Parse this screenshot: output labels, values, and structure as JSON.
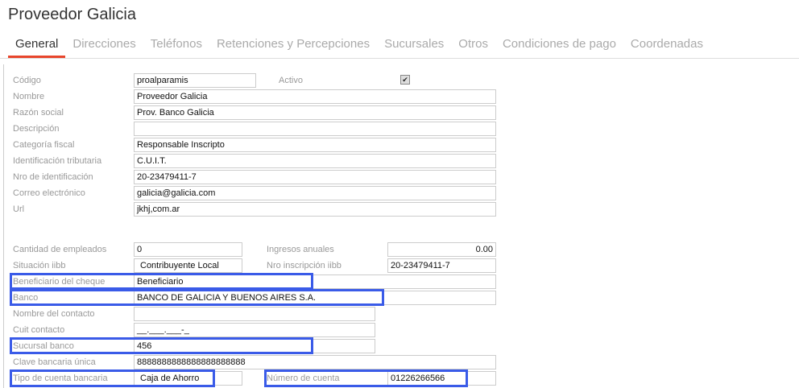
{
  "title": "Proveedor Galicia",
  "tabs": [
    "General",
    "Direcciones",
    "Teléfonos",
    "Retenciones y Percepciones",
    "Sucursales",
    "Otros",
    "Condiciones de pago",
    "Coordenadas"
  ],
  "fields": {
    "codigo": {
      "label": "Código",
      "value": "proalparamis"
    },
    "activo": {
      "label": "Activo",
      "checked": true,
      "mark": "✔"
    },
    "nombre": {
      "label": "Nombre",
      "value": "Proveedor Galicia"
    },
    "razon": {
      "label": "Razón social",
      "value": "Prov. Banco Galicia"
    },
    "descripcion": {
      "label": "Descripción",
      "value": ""
    },
    "categoria": {
      "label": "Categoría fiscal",
      "value": "Responsable Inscripto"
    },
    "identificacion": {
      "label": "Identificación tributaria",
      "value": "C.U.I.T."
    },
    "nro_id": {
      "label": "Nro de identificación",
      "value": "20-23479411-7"
    },
    "correo": {
      "label": "Correo electrónico",
      "value": "galicia@galicia.com"
    },
    "url": {
      "label": "Url",
      "value": "jkhj,com.ar"
    },
    "empleados": {
      "label": "Cantidad de empleados",
      "value": "0"
    },
    "ingresos": {
      "label": "Ingresos anuales",
      "value": "0.00"
    },
    "situacion": {
      "label": "Situación iibb",
      "value": "Contribuyente Local"
    },
    "nro_iibb": {
      "label": "Nro inscripción iibb",
      "value": "20-23479411-7"
    },
    "beneficiario": {
      "label": "Beneficiario del cheque",
      "value": "Beneficiario"
    },
    "banco": {
      "label": "Banco",
      "value": "BANCO DE GALICIA Y BUENOS AIRES S.A."
    },
    "contacto": {
      "label": "Nombre del contacto",
      "value": ""
    },
    "cuit_contacto": {
      "label": "Cuit contacto",
      "value": "__.___.___-_"
    },
    "sucursal": {
      "label": "Sucursal banco",
      "value": "456"
    },
    "cbu": {
      "label": "Clave bancaria única",
      "value": "8888888888888888888888"
    },
    "tipo_cuenta": {
      "label": "Tipo de cuenta bancaria",
      "value": "Caja de Ahorro"
    },
    "numero_cuenta": {
      "label": "Número de cuenta",
      "value": "01226266566"
    }
  }
}
